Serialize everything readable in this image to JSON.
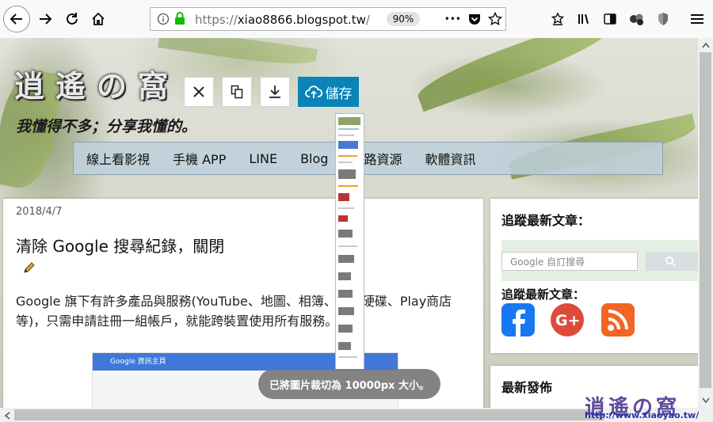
{
  "browser": {
    "url_scheme": "https://",
    "url_host": "xiao8866.blogspot.tw",
    "url_tail": "/",
    "zoom": "90%",
    "more_label": "•••"
  },
  "site": {
    "logo_text": "逍遙の窩",
    "tagline": "我懂得不多；分享我懂的。",
    "menu": [
      "線上看影視",
      "手機 APP",
      "LINE",
      "Blog",
      "網路資源",
      "軟體資訊"
    ]
  },
  "post": {
    "date": "2018/4/7",
    "title": "清除 Google 搜尋紀錄，關閉",
    "body": "Google 旗下有許多產品與服務(YouTube、地圖、相簿、雲端硬碟、Play商店等)，只需申請註冊一組帳戶，就能跨裝置使用所有服務。",
    "embedded_header": "Google 資訊主頁"
  },
  "sidebar": {
    "heading_top": "追蹤最新文章：",
    "search_placeholder": "Google 自訂搜尋",
    "heading_follow": "追蹤最新文章：",
    "heading_recent": "最新發佈"
  },
  "overlay": {
    "save_label": "儲存",
    "toast": "已將圖片裁切為 10000px 大小。"
  },
  "watermark": {
    "text": "逍遙の窩",
    "url": "http://www.xiaoyao.tw/"
  }
}
